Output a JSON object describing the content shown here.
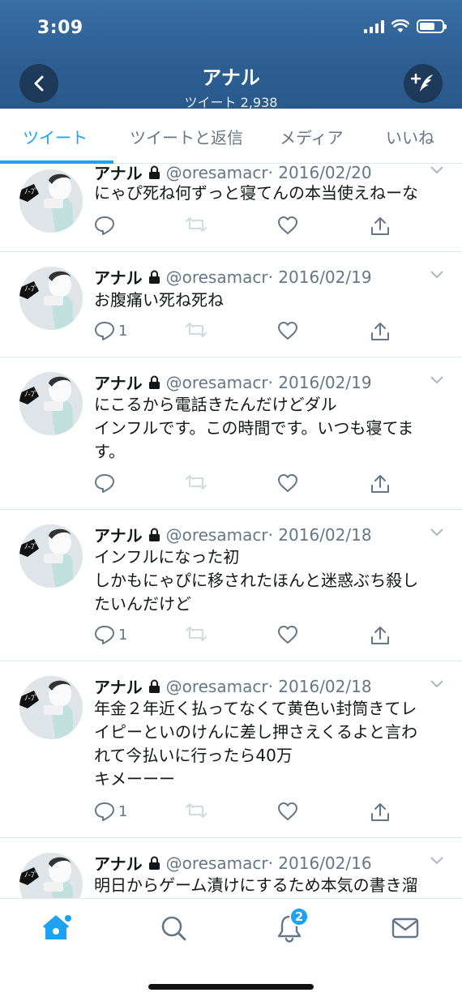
{
  "status_bar": {
    "time": "3:09"
  },
  "header": {
    "name": "アナル",
    "tweet_count": "ツイート 2,938"
  },
  "tabs": [
    {
      "label": "ツイート",
      "active": true
    },
    {
      "label": "ツイートと返信",
      "active": false
    },
    {
      "label": "メディア",
      "active": false
    },
    {
      "label": "いいね",
      "active": false
    }
  ],
  "tweets": [
    {
      "name": "アナル",
      "handle": "@oresamacr",
      "date": "· 2016/02/20",
      "lines": [
        "にゃぴ死ね何ずっと寝てんの本当使えねーな"
      ],
      "reply_count": ""
    },
    {
      "name": "アナル",
      "handle": "@oresamacr",
      "date": "· 2016/02/19",
      "lines": [
        "お腹痛い死ね死ね"
      ],
      "reply_count": "1"
    },
    {
      "name": "アナル",
      "handle": "@oresamacr",
      "date": "· 2016/02/19",
      "lines": [
        "にこるから電話きたんだけどダル",
        "インフルです。この時間です。いつも寝てま",
        "す。"
      ],
      "reply_count": ""
    },
    {
      "name": "アナル",
      "handle": "@oresamacr",
      "date": "· 2016/02/18",
      "lines": [
        "インフルになった初",
        "しかもにゃぴに移されたほんと迷惑ぶち殺し",
        "たいんだけど"
      ],
      "reply_count": "1"
    },
    {
      "name": "アナル",
      "handle": "@oresamacr",
      "date": "· 2016/02/18",
      "lines": [
        "年金２年近く払ってなくて黄色い封筒きてレ",
        "イピーといのけんに差し押さえくるよと言わ",
        "れて今払いに行ったら40万",
        "キメーーー"
      ],
      "reply_count": "1"
    },
    {
      "name": "アナル",
      "handle": "@oresamacr",
      "date": "· 2016/02/16",
      "lines": [
        "明日からゲーム漬けにするため本気の書き溜"
      ],
      "reply_count": ""
    }
  ],
  "bottom_nav": {
    "notification_badge": "2"
  },
  "colors": {
    "accent": "#1da1f2",
    "header_bg": "#2d5f93",
    "muted": "#657786"
  }
}
